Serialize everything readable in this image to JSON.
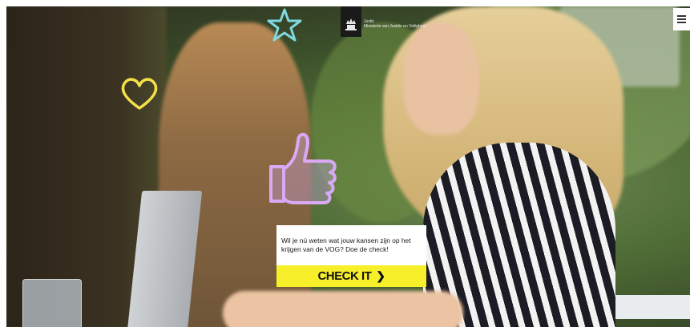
{
  "header": {
    "logo_icon": "crown-emblem-icon",
    "logo_line1": "Justis",
    "logo_line2": "Ministerie van Justitie en Veiligheid"
  },
  "menu": {
    "icon": "hamburger-menu-icon"
  },
  "decorations": [
    "star-doodle-icon",
    "heart-doodle-icon",
    "thumbs-up-doodle-icon"
  ],
  "cta": {
    "text": "Wil je nú weten wat jouw kansen zijn op het krijgen van de VOG? Doe de check!",
    "button_label": "CHECK IT",
    "button_icon": "chevron-right-icon",
    "button_color": "#f7ef2a"
  }
}
